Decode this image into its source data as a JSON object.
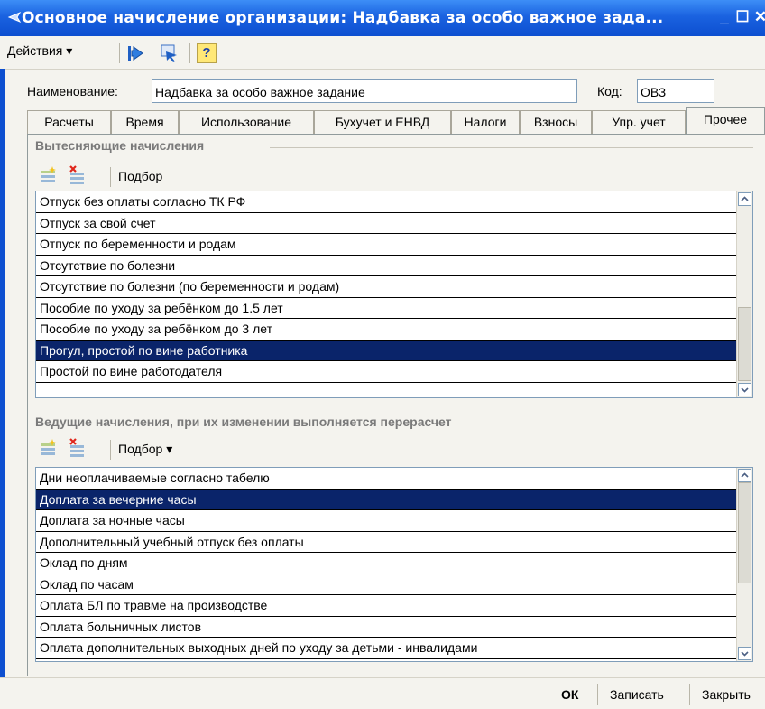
{
  "window": {
    "title": "Основное начисление организации: Надбавка за особо важное зада...",
    "minimize": "_",
    "maximize": "☐",
    "close": "✕"
  },
  "toolbar": {
    "actions_label": "Действия ▾",
    "help_label": "?"
  },
  "form": {
    "name_label": "Наименование:",
    "name_value": "Надбавка за особо важное задание",
    "code_label": "Код:",
    "code_value": "ОВЗ"
  },
  "tabs": [
    {
      "label": "Расчеты"
    },
    {
      "label": "Время"
    },
    {
      "label": "Использование"
    },
    {
      "label": "Бухучет и ЕНВД"
    },
    {
      "label": "Налоги"
    },
    {
      "label": "Взносы"
    },
    {
      "label": "Упр. учет"
    },
    {
      "label": "Прочее"
    }
  ],
  "active_tab": "Прочее",
  "displacing": {
    "title": "Вытесняющие начисления",
    "pick_label": "Подбор",
    "items": [
      "Отпуск без оплаты согласно ТК РФ",
      "Отпуск за свой счет",
      "Отпуск по беременности и родам",
      "Отсутствие по болезни",
      "Отсутствие по болезни (по беременности и родам)",
      "Пособие по уходу за ребёнком до 1.5 лет",
      "Пособие по уходу за ребёнком до 3 лет",
      "Прогул, простой по вине работника",
      "Простой по вине работодателя"
    ],
    "selected_index": 7
  },
  "leading": {
    "title": "Ведущие начисления, при их изменении выполняется перерасчет",
    "pick_label": "Подбор ▾",
    "items": [
      "Дни неоплачиваемые согласно табелю",
      "Доплата за вечерние часы",
      "Доплата за ночные часы",
      "Дополнительный учебный отпуск без оплаты",
      "Оклад по дням",
      "Оклад по часам",
      "Оплата БЛ по травме на производстве",
      "Оплата больничных листов",
      "Оплата дополнительных выходных дней по уходу за детьми - инвалидами"
    ],
    "selected_index": 1
  },
  "footer": {
    "ok_label": "ОК",
    "save_label": "Записать",
    "close_label": "Закрыть"
  },
  "colors": {
    "titlebar": "#1a62e0",
    "selection": "#0a246a",
    "window_bg": "#f4f3ee"
  }
}
